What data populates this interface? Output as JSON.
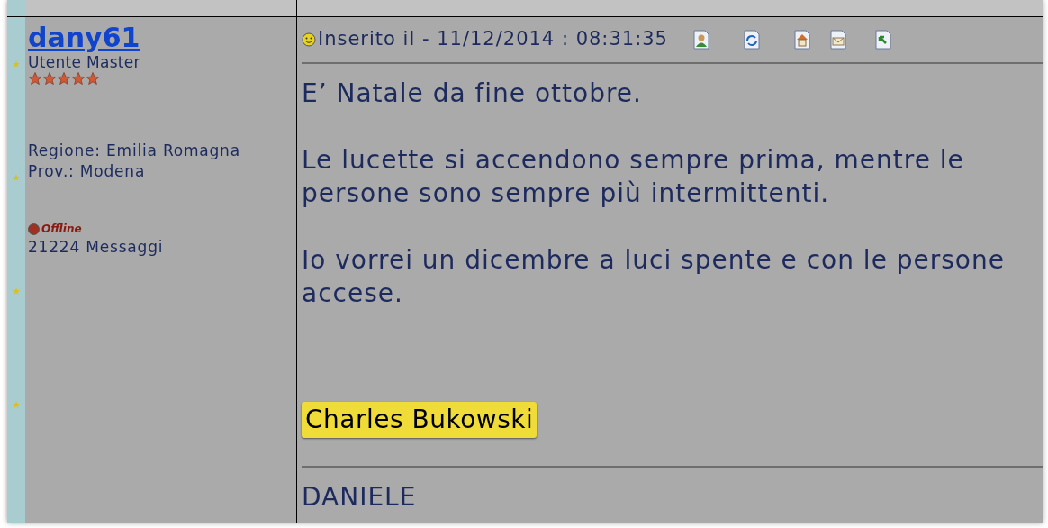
{
  "post": {
    "author": "dany61",
    "rank": "Utente Master",
    "stars": 5,
    "region": "Regione: Emilia Romagna",
    "province": "Prov.: Modena",
    "status": {
      "kind": "offline",
      "label": "Offline"
    },
    "message_count": "21224 Messaggi",
    "posted": "Inserito il - 11/12/2014 : 08:31:35",
    "paragraphs": [
      "E’ Natale da fine ottobre.",
      "Le lucette si accendono sempre prima, mentre le persone sono sempre più intermittenti.",
      "Io vorrei un dicembre a luci spente e con le persone accese."
    ],
    "highlight": "Charles Bukowski",
    "signature": "DANIELE"
  }
}
